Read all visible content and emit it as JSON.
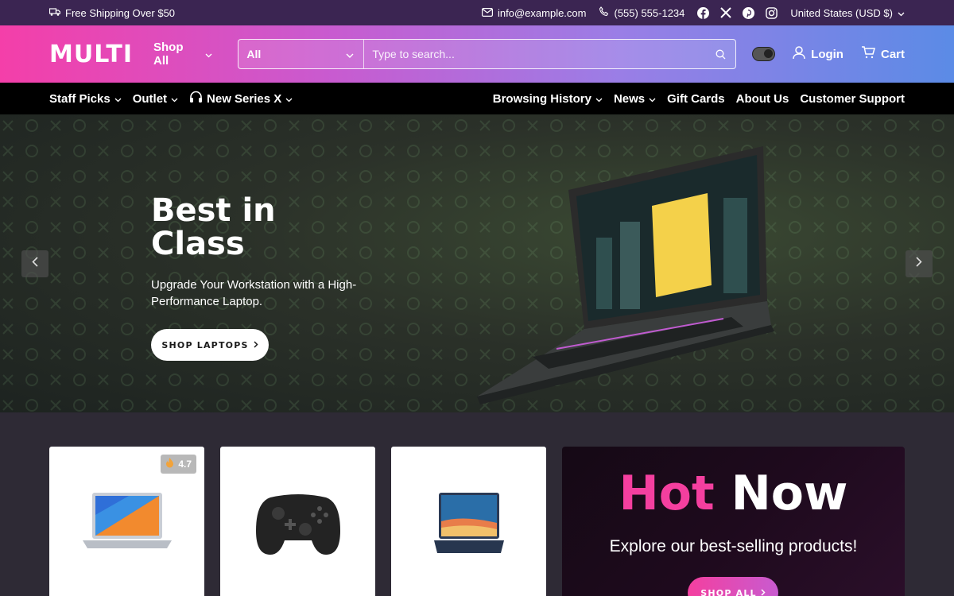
{
  "topbar": {
    "shipping": "Free Shipping Over $50",
    "email": "info@example.com",
    "phone": "(555) 555-1234",
    "social": [
      "facebook-icon",
      "x-icon",
      "pinterest-icon",
      "instagram-icon"
    ],
    "region": "United States (USD $)"
  },
  "header": {
    "logo": "MULTI",
    "shop_all": "Shop All",
    "search": {
      "category": "All",
      "placeholder": "Type to search..."
    },
    "login": "Login",
    "cart": "Cart"
  },
  "nav": {
    "left": [
      {
        "label": "Staff Picks",
        "dropdown": true
      },
      {
        "label": "Outlet",
        "dropdown": true
      },
      {
        "label": "New Series X",
        "dropdown": true,
        "icon": "headphones-icon"
      }
    ],
    "right": [
      {
        "label": "Browsing History",
        "dropdown": true
      },
      {
        "label": "News",
        "dropdown": true
      },
      {
        "label": "Gift Cards"
      },
      {
        "label": "About Us"
      },
      {
        "label": "Customer Support"
      }
    ]
  },
  "hero": {
    "title": "Best in Class",
    "subtitle": "Upgrade Your Workstation with a High-Performance Laptop.",
    "cta": "SHOP LAPTOPS"
  },
  "products": [
    {
      "rating": "4.7",
      "image": "laptop-silver"
    },
    {
      "image": "game-controller"
    },
    {
      "image": "laptop-blue"
    }
  ],
  "promo": {
    "title_highlight": "Hot",
    "title_rest": "Now",
    "description": "Explore our best-selling products!",
    "cta": "SHOP ALL"
  },
  "colors": {
    "accent_pink": "#f43f9f",
    "topbar_bg": "#3b2552",
    "nav_bg": "#000000"
  }
}
